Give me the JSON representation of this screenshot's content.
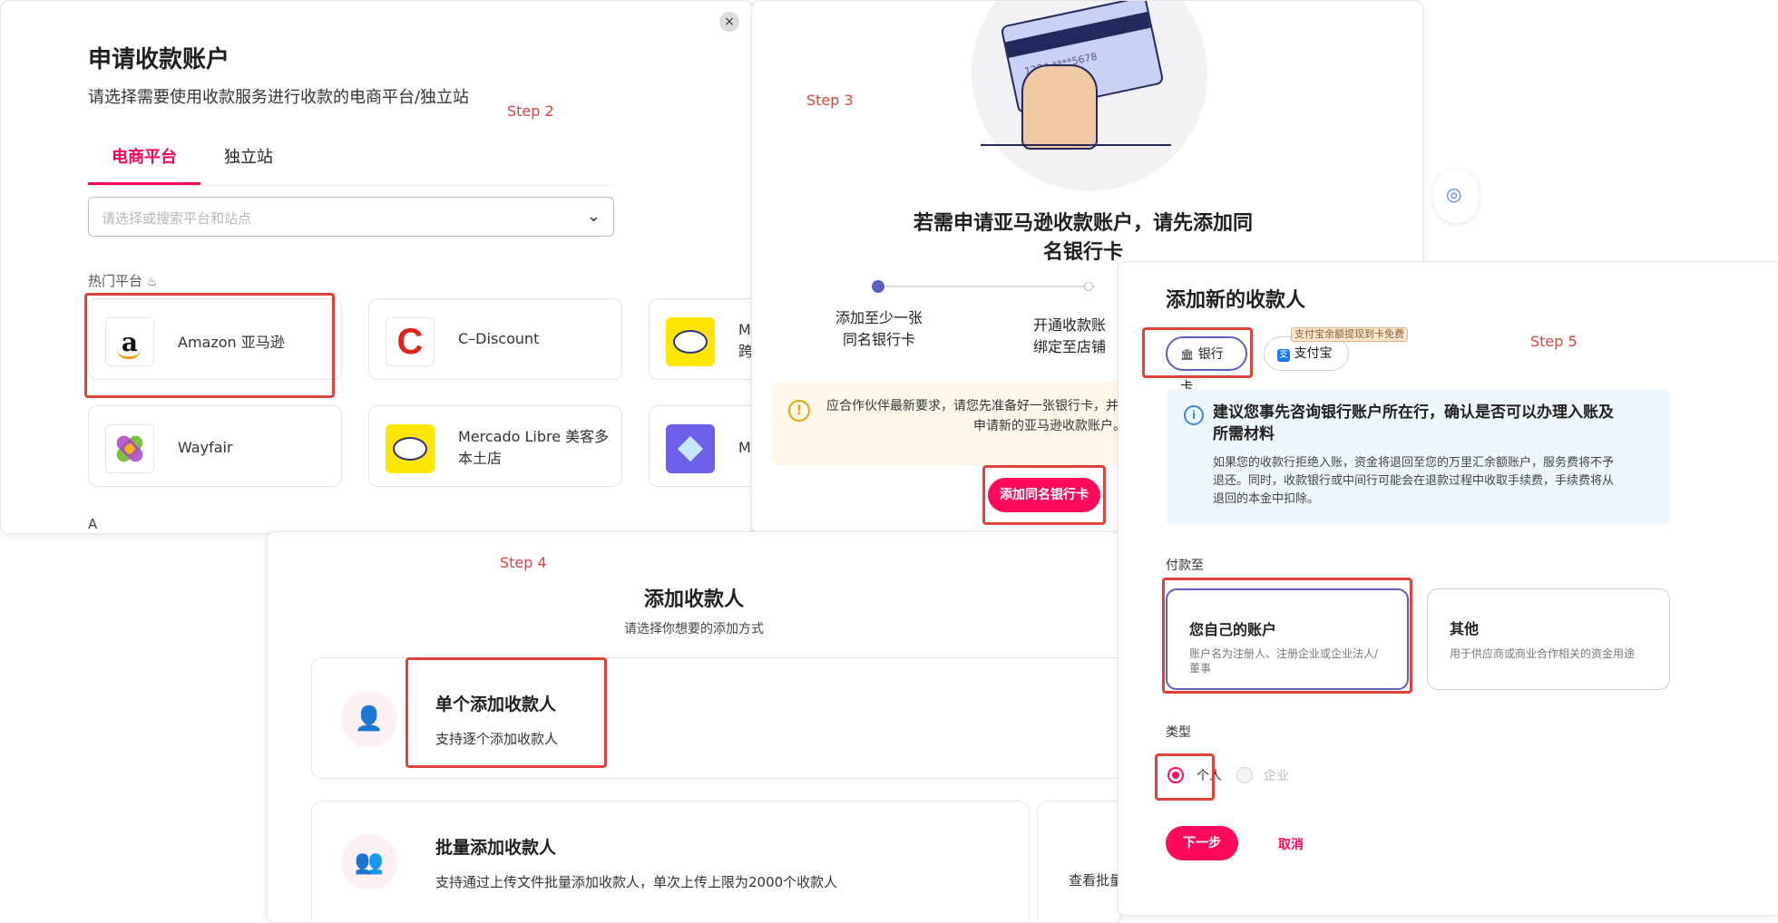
{
  "colors": {
    "accent": "#ff0056",
    "step_red": "#e0413a",
    "notice_bg": "#fff8ea",
    "info_bg": "#eef7fd"
  },
  "panel1": {
    "title": "申请收款账户",
    "subtitle": "请选择需要使用收款服务进行收款的电商平台/独立站",
    "close_icon": "×",
    "step_label": "Step 2",
    "tabs": [
      {
        "label": "电商平台"
      },
      {
        "label": "独立站"
      }
    ],
    "search_placeholder": "请选择或搜索平台和站点",
    "chevron": "⌄",
    "hot_label": "热门平台",
    "hot_icon": "♨",
    "platforms": [
      {
        "name": "Amazon 亚马逊",
        "logo": "a"
      },
      {
        "name": "C–Discount",
        "logo": "C"
      },
      {
        "name": "M",
        "name2": "跨",
        "logo": ""
      },
      {
        "name": "Wayfair",
        "logo": ""
      },
      {
        "name": "Mercado Libre 美客多",
        "name2": "本土店",
        "logo": ""
      },
      {
        "name": "M",
        "logo": ""
      }
    ],
    "section_a": "A"
  },
  "panel2": {
    "step_label": "Step 3",
    "card_number": "1234 ****5678",
    "title_line1": "若需申请亚马逊收款账户，请先添加同",
    "title_line2": "名银行卡",
    "step1_line1": "添加至少一张",
    "step1_line2": "同名银行卡",
    "step2_line1": "开通收款账",
    "step2_line2": "绑定至店铺",
    "notice_line1": "应合作伙伴最新要求，请您先准备好一张银行卡，并",
    "notice_line2": "申请新的亚马逊收款账户。有",
    "warn_icon": "!",
    "button": "添加同名银行卡"
  },
  "panel3": {
    "title": "添加新的收款人",
    "step_label": "Step 5",
    "bank_tab": "银行卡",
    "bank_icon": "🏛",
    "alipay_tab": "支付宝",
    "alipay_icon": "支",
    "alipay_badge": "支付宝余额提现到卡免费",
    "info_icon": "i",
    "info_title_1": "建议您事先咨询银行账户所在行，确认是否可以办理入账及",
    "info_title_2": "所需材料",
    "info_body_1": "如果您的收款行拒绝入账，资金将退回至您的万里汇余额账户，服务费将不予",
    "info_body_2": "退还。同时，收款银行或中间行可能会在退款过程中收取手续费，手续费将从",
    "info_body_3": "退回的本金中扣除。",
    "pay_to_label": "付款至",
    "option_own_title": "您自己的账户",
    "option_own_desc_1": "账户名为注册人、注册企业或企业法人/",
    "option_own_desc_2": "董事",
    "option_other_title": "其他",
    "option_other_desc": "用于供应商或商业合作相关的资金用途",
    "type_label": "类型",
    "type_personal": "个人",
    "type_business": "企业",
    "next_button": "下一步",
    "cancel_button": "取消"
  },
  "panel4": {
    "step_label": "Step 4",
    "title": "添加收款人",
    "subtitle": "请选择你想要的添加方式",
    "single_icon": "👤",
    "single_title": "单个添加收款人",
    "single_desc": "支持逐个添加收款人",
    "batch_icon": "👥",
    "batch_title": "批量添加收款人",
    "batch_desc": "支持通过上传文件批量添加收款人，单次上传上限为2000个收款人",
    "partial_text": "查看批量"
  },
  "background": {
    "lens_icon": "◎",
    "stray_mark": "✓"
  }
}
